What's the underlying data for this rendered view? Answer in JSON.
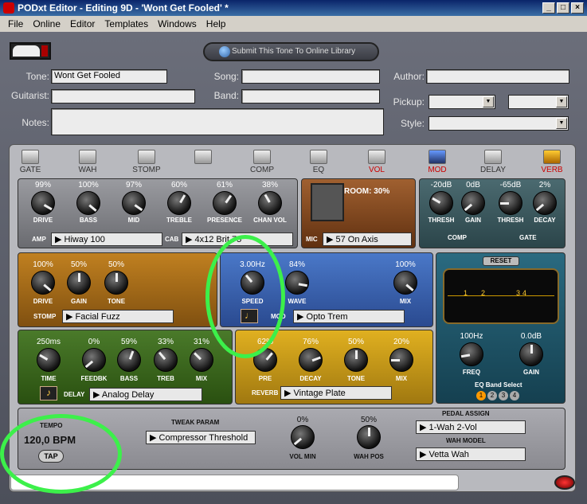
{
  "window": {
    "title": "PODxt Editor - Editing 9D - 'Wont Get Fooled' *",
    "buttons": [
      "_",
      "□",
      "×"
    ]
  },
  "menu": [
    "File",
    "Online",
    "Editor",
    "Templates",
    "Windows",
    "Help"
  ],
  "submit_label": "Submit This Tone To Online Library",
  "fields": {
    "tone_label": "Tone:",
    "tone_value": "Wont Get Fooled",
    "song_label": "Song:",
    "author_label": "Author:",
    "guitarist_label": "Guitarist:",
    "band_label": "Band:",
    "pickup_label": "Pickup:",
    "notes_label": "Notes:",
    "style_label": "Style:"
  },
  "modules": [
    {
      "label": "GATE",
      "active": false
    },
    {
      "label": "WAH",
      "active": false
    },
    {
      "label": "STOMP",
      "active": false
    },
    {
      "label": "",
      "active": false
    },
    {
      "label": "COMP",
      "active": false
    },
    {
      "label": "EQ",
      "active": false
    },
    {
      "label": "VOL",
      "active": true
    },
    {
      "label": "MOD",
      "active": true
    },
    {
      "label": "DELAY",
      "active": false
    },
    {
      "label": "VERB",
      "active": true
    }
  ],
  "amp": {
    "knobs": [
      {
        "v": "99%",
        "l": "DRIVE"
      },
      {
        "v": "100%",
        "l": "BASS"
      },
      {
        "v": "97%",
        "l": "MID"
      },
      {
        "v": "60%",
        "l": "TREBLE"
      },
      {
        "v": "61%",
        "l": "PRESENCE"
      },
      {
        "v": "38%",
        "l": "CHAN VOL"
      }
    ],
    "amp_tag": "AMP",
    "amp_model": "▶ Hiway 100",
    "cab_tag": "CAB",
    "cab_model": "▶ 4x12 Brit 75"
  },
  "room": {
    "label": "ROOM: 30%",
    "mic_tag": "MIC",
    "mic_model": "▶ 57 On Axis"
  },
  "comp": {
    "knobs": [
      {
        "v": "-20dB",
        "l": "THRESH"
      },
      {
        "v": "0dB",
        "l": "GAIN"
      }
    ],
    "tag": "COMP"
  },
  "gate": {
    "knobs": [
      {
        "v": "-65dB",
        "l": "THRESH"
      },
      {
        "v": "2%",
        "l": "DECAY"
      }
    ],
    "tag": "GATE"
  },
  "stomp": {
    "knobs": [
      {
        "v": "100%",
        "l": "DRIVE"
      },
      {
        "v": "50%",
        "l": "GAIN"
      },
      {
        "v": "50%",
        "l": "TONE"
      }
    ],
    "tag": "STOMP",
    "model": "▶ Facial Fuzz"
  },
  "mod": {
    "knobs": [
      {
        "v": "3.00Hz",
        "l": "SPEED"
      },
      {
        "v": "84%",
        "l": "WAVE"
      },
      {
        "v": "100%",
        "l": "MIX"
      }
    ],
    "tag": "MOD",
    "model": "▶ Opto Trem"
  },
  "eq": {
    "reset": "RESET",
    "points": [
      "1",
      "2",
      "3",
      "4"
    ],
    "knobs": [
      {
        "v": "100Hz",
        "l": "FREQ"
      },
      {
        "v": "0.0dB",
        "l": "GAIN"
      }
    ],
    "band_label": "EQ Band Select",
    "bands": [
      "1",
      "2",
      "3",
      "4"
    ]
  },
  "delay": {
    "knobs": [
      {
        "v": "250ms",
        "l": "TIME"
      },
      {
        "v": "0%",
        "l": "FEEDBK"
      },
      {
        "v": "59%",
        "l": "BASS"
      },
      {
        "v": "33%",
        "l": "TREB"
      },
      {
        "v": "31%",
        "l": "MIX"
      }
    ],
    "tag": "DELAY",
    "model": "▶ Analog Delay"
  },
  "reverb": {
    "knobs": [
      {
        "v": "62%",
        "l": "PRE"
      },
      {
        "v": "76%",
        "l": "DECAY"
      },
      {
        "v": "50%",
        "l": "TONE"
      },
      {
        "v": "20%",
        "l": "MIX"
      }
    ],
    "tag": "REVERB",
    "model": "▶ Vintage Plate"
  },
  "bottom": {
    "tempo_label": "TEMPO",
    "tempo_value": "120,0 BPM",
    "tap": "TAP",
    "tweak_label": "TWEAK PARAM",
    "tweak_value": "▶ Compressor Threshold",
    "volmin_v": "0%",
    "volmin_l": "VOL MIN",
    "wahpos_v": "50%",
    "wahpos_l": "WAH POS",
    "pedal_label": "PEDAL ASSIGN",
    "pedal_value": "▶ 1-Wah  2-Vol",
    "wahmodel_label": "WAH MODEL",
    "wahmodel_value": "▶ Vetta Wah"
  }
}
